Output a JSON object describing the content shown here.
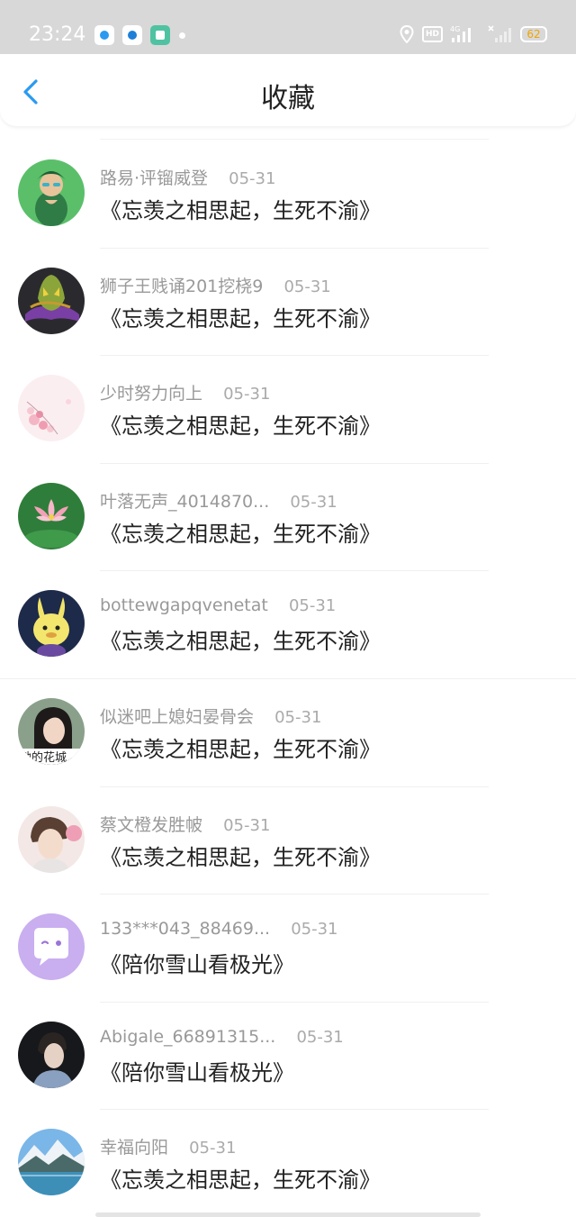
{
  "status_bar": {
    "time": "23:24",
    "network": "4G",
    "hd": "HD",
    "battery": "62",
    "icons": [
      "qq-browser-icon",
      "target-app-icon",
      "grid-app-icon",
      "location-icon",
      "signal-icon",
      "battery-icon"
    ]
  },
  "header": {
    "back_icon": "chevron-left-icon",
    "title": "收藏"
  },
  "colors": {
    "accent": "#2a9af0",
    "title_text": "#222222",
    "meta_text": "#999999",
    "status_bar_bg": "#d8d8d8",
    "battery_text": "#f0a400"
  },
  "favorites": [
    {
      "user": "路易·评镏威登",
      "date": "05-31",
      "title": "《忘羡之相思起，生死不渝》",
      "avatar": "green-hair-avatar"
    },
    {
      "user": "狮子王贱诵201挖桡9",
      "date": "05-31",
      "title": "《忘羡之相思起，生死不渝》",
      "avatar": "dark-creature-avatar"
    },
    {
      "user": "少时努力向上",
      "date": "05-31",
      "title": "《忘羡之相思起，生死不渝》",
      "avatar": "pink-blossom-avatar"
    },
    {
      "user": "叶落无声_4014870...",
      "date": "05-31",
      "title": "《忘羡之相思起，生死不渝》",
      "avatar": "lotus-avatar"
    },
    {
      "user": "bottewgapqvenetat",
      "date": "05-31",
      "title": "《忘羡之相思起，生死不渝》",
      "avatar": "yellow-bunny-avatar"
    },
    {
      "user": "似迷吧上媳妇晏骨会",
      "date": "05-31",
      "title": "《忘羡之相思起，生死不渝》",
      "avatar": "girl-portrait-avatar",
      "avatar_caption": "她的花城"
    },
    {
      "user": "蔡文橙发胜帔",
      "date": "05-31",
      "title": "《忘羡之相思起，生死不渝》",
      "avatar": "boy-portrait-avatar"
    },
    {
      "user": "133***043_88469...",
      "date": "05-31",
      "title": "《陪你雪山看极光》",
      "avatar": "purple-chat-avatar"
    },
    {
      "user": "Abigale_66891315...",
      "date": "05-31",
      "title": "《陪你雪山看极光》",
      "avatar": "dark-portrait-avatar"
    },
    {
      "user": "幸福向阳",
      "date": "05-31",
      "title": "《忘羡之相思起，生死不渝》",
      "avatar": "mountain-lake-avatar"
    }
  ]
}
